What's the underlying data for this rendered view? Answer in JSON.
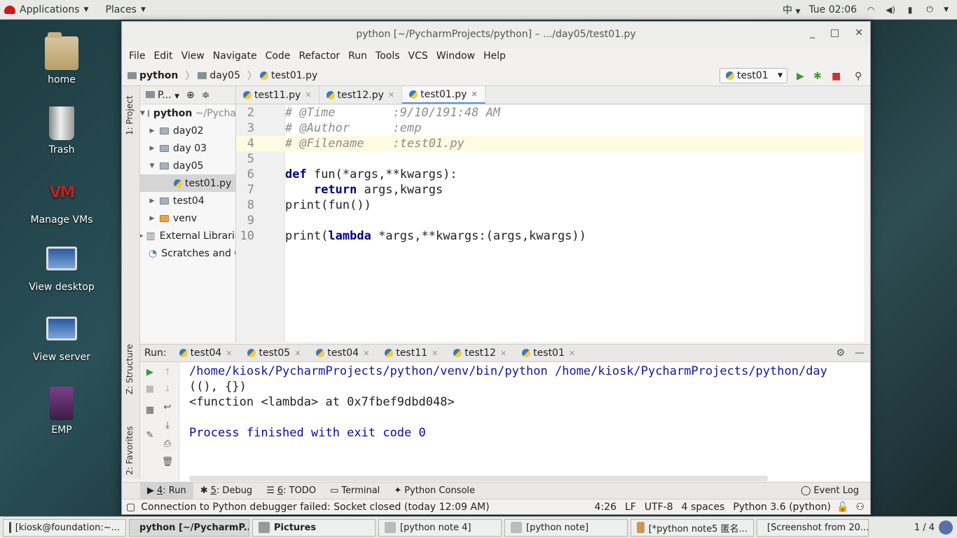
{
  "topbar": {
    "applications": "Applications",
    "places": "Places",
    "input_method": "中",
    "clock": "Tue 02:06"
  },
  "desktop": {
    "icons": [
      {
        "label": "home"
      },
      {
        "label": "Trash"
      },
      {
        "label": "Manage VMs"
      },
      {
        "label": "View desktop"
      },
      {
        "label": "View server"
      },
      {
        "label": "EMP"
      }
    ]
  },
  "window": {
    "title": "python [~/PycharmProjects/python] – .../day05/test01.py",
    "menu": [
      "File",
      "Edit",
      "View",
      "Navigate",
      "Code",
      "Refactor",
      "Run",
      "Tools",
      "VCS",
      "Window",
      "Help"
    ],
    "breadcrumb": [
      "python",
      "day05",
      "test01.py"
    ],
    "run_config": "test01"
  },
  "project": {
    "header": "P...",
    "stripe_tabs": {
      "project": "1: Project",
      "structure": "Z: Structure",
      "favorites": "2: Favorites"
    },
    "root_name": "python",
    "root_path": "~/Pycha",
    "items": [
      "day02",
      "day 03",
      "day05",
      "test01.py",
      "test04",
      "venv",
      "External Librarie",
      "Scratches and C"
    ]
  },
  "editor": {
    "tabs": [
      "test11.py",
      "test12.py",
      "test01.py"
    ],
    "active_tab": "test01.py",
    "lines": [
      {
        "num": "2",
        "text": "# @Time        :9/10/191:48 AM"
      },
      {
        "num": "3",
        "text": "# @Author      :emp"
      },
      {
        "num": "4",
        "text": "# @Filename    :test01.py"
      },
      {
        "num": "5",
        "text": ""
      },
      {
        "num": "6",
        "kw": "def",
        "text": " fun(*args,**kwargs):"
      },
      {
        "num": "7",
        "indent": "    ",
        "kw": "return",
        "text": " args,kwargs"
      },
      {
        "num": "8",
        "text": "print(fun())"
      },
      {
        "num": "9",
        "text": ""
      },
      {
        "num": "10",
        "pre": "print(",
        "kw": "lambda",
        "text": " *args,**kwargs:(args,kwargs))"
      }
    ]
  },
  "run": {
    "label": "Run:",
    "tabs": [
      "test04",
      "test05",
      "test04",
      "test11",
      "test12",
      "test01"
    ],
    "output": [
      "/home/kiosk/PycharmProjects/python/venv/bin/python /home/kiosk/PycharmProjects/python/day",
      "((), {})",
      "<function <lambda> at 0x7fbef9dbd048>",
      "",
      "Process finished with exit code 0"
    ]
  },
  "tooltabs": [
    {
      "num": "4",
      "label": ": Run"
    },
    {
      "num": "5",
      "label": ": Debug"
    },
    {
      "num": "6",
      "label": ": TODO"
    },
    {
      "num": "",
      "label": "Terminal"
    },
    {
      "num": "",
      "label": "Python Console"
    }
  ],
  "event_log": "Event Log",
  "status": {
    "message": "Connection to Python debugger failed: Socket closed (today 12:09 AM)",
    "position": "4:26",
    "line_sep": "LF",
    "encoding": "UTF-8",
    "indent": "4 spaces",
    "interpreter": "Python 3.6 (python)"
  },
  "taskbar": {
    "tasks": [
      "[kiosk@foundation:~...",
      "python [~/PycharmP...",
      "Pictures",
      "[python note 4]",
      "[python note]",
      "[*python note5 匿名...",
      "[Screenshot from 20..."
    ],
    "pager": "1 / 4"
  }
}
